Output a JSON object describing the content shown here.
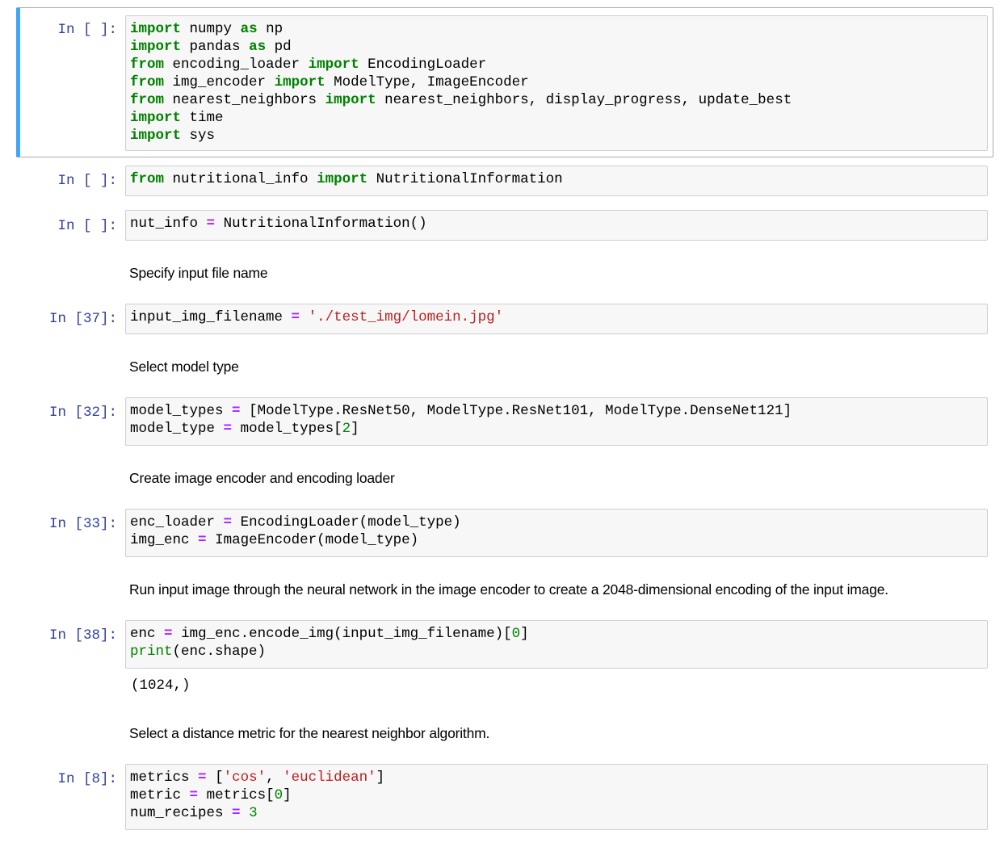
{
  "cells": [
    {
      "prompt": "In [ ]:",
      "lines": [
        [
          [
            "kw",
            "import"
          ],
          [
            "",
            "numpy"
          ],
          [
            "kw",
            "as"
          ],
          [
            "",
            "np"
          ]
        ],
        [
          [
            "kw",
            "import"
          ],
          [
            "",
            "pandas"
          ],
          [
            "kw",
            "as"
          ],
          [
            "",
            "pd"
          ]
        ],
        [
          [
            "kw",
            "from"
          ],
          [
            "",
            "encoding_loader"
          ],
          [
            "kw",
            "import"
          ],
          [
            "",
            "EncodingLoader"
          ]
        ],
        [
          [
            "kw",
            "from"
          ],
          [
            "",
            "img_encoder"
          ],
          [
            "kw",
            "import"
          ],
          [
            "",
            "ModelType, ImageEncoder"
          ]
        ],
        [
          [
            "kw",
            "from"
          ],
          [
            "",
            "nearest_neighbors"
          ],
          [
            "kw",
            "import"
          ],
          [
            "",
            "nearest_neighbors, display_progress, update_best"
          ]
        ],
        [
          [
            "kw",
            "import"
          ],
          [
            "",
            "time"
          ]
        ],
        [
          [
            "kw",
            "import"
          ],
          [
            "",
            "sys"
          ]
        ]
      ]
    },
    {
      "prompt": "In [ ]:",
      "lines": [
        [
          [
            "kw",
            "from"
          ],
          [
            "",
            "nutritional_info"
          ],
          [
            "kw",
            "import"
          ],
          [
            "",
            "NutritionalInformation"
          ]
        ]
      ]
    },
    {
      "prompt": "In [ ]:",
      "lines": [
        [
          [
            "",
            "nut_info"
          ],
          [
            "op",
            "="
          ],
          [
            "",
            "NutritionalInformation()"
          ]
        ]
      ]
    },
    {
      "prompt": "In [37]:",
      "lines": [
        [
          [
            "",
            "input_img_filename"
          ],
          [
            "op",
            "="
          ],
          [
            "str",
            "'./test_img/lomein.jpg'"
          ]
        ]
      ]
    },
    {
      "prompt": "In [32]:",
      "lines": [
        [
          [
            "",
            "model_types"
          ],
          [
            "op",
            "="
          ],
          [
            "",
            "[ModelType.ResNet50, ModelType.ResNet101, ModelType.DenseNet121]"
          ]
        ],
        [
          [
            "",
            "model_type"
          ],
          [
            "op",
            "="
          ],
          [
            "",
            "model_types["
          ],
          [
            "num",
            "2"
          ],
          [
            "",
            "]"
          ]
        ]
      ]
    },
    {
      "prompt": "In [33]:",
      "lines": [
        [
          [
            "",
            "enc_loader"
          ],
          [
            "op",
            "="
          ],
          [
            "",
            "EncodingLoader(model_type)"
          ]
        ],
        [
          [
            "",
            "img_enc"
          ],
          [
            "op",
            "="
          ],
          [
            "",
            "ImageEncoder(model_type)"
          ]
        ]
      ]
    },
    {
      "prompt": "In [38]:",
      "lines": [
        [
          [
            "",
            "enc"
          ],
          [
            "op",
            "="
          ],
          [
            "",
            "img_enc.encode_img(input_img_filename)["
          ],
          [
            "num",
            "0"
          ],
          [
            "",
            "]"
          ]
        ],
        [
          [
            "bi",
            "print"
          ],
          [
            "",
            "(enc.shape)"
          ]
        ]
      ],
      "output": "(1024,)"
    },
    {
      "prompt": "In [8]:",
      "lines": [
        [
          [
            "",
            "metrics"
          ],
          [
            "op",
            "="
          ],
          [
            "",
            "["
          ],
          [
            "str",
            "'cos'"
          ],
          [
            "",
            ", "
          ],
          [
            "str",
            "'euclidean'"
          ],
          [
            "",
            "]"
          ]
        ],
        [
          [
            "",
            "metric"
          ],
          [
            "op",
            "="
          ],
          [
            "",
            "metrics["
          ],
          [
            "num",
            "0"
          ],
          [
            "",
            "]"
          ]
        ],
        [
          [
            "",
            "num_recipes"
          ],
          [
            "op",
            "="
          ],
          [
            "num",
            "3"
          ]
        ]
      ]
    }
  ],
  "markdown": [
    "Specify input file name",
    "Select model type",
    "Create image encoder and encoding loader",
    "Run input image through the neural network in the image encoder to create a 2048-dimensional encoding of the input image.",
    "Select a distance metric for the nearest neighbor algorithm."
  ]
}
